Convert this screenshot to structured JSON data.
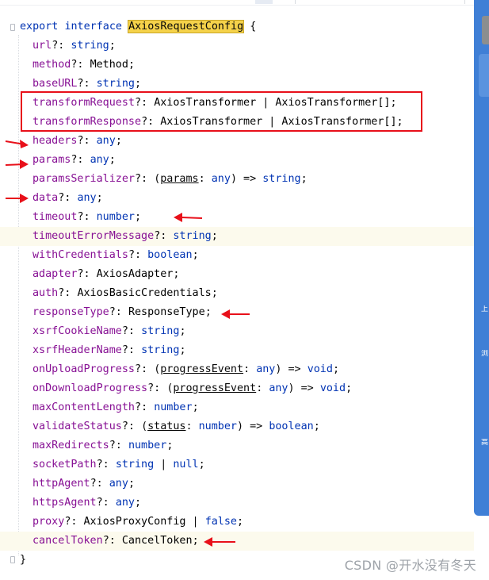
{
  "code": {
    "open": {
      "kw1": "export",
      "kw2": "interface",
      "name": "AxiosRequestConfig",
      "brace": "{"
    },
    "close": "}",
    "lines": [
      {
        "name": "url",
        "opt": "?: ",
        "type": "string",
        "suffix": ";"
      },
      {
        "name": "method",
        "opt": "?: ",
        "type": "Method",
        "suffix": ";"
      },
      {
        "name": "baseURL",
        "opt": "?: ",
        "type": "string",
        "suffix": ";"
      },
      {
        "name": "transformRequest",
        "opt": "?: ",
        "type": "AxiosTransformer | AxiosTransformer[]",
        "suffix": ";"
      },
      {
        "name": "transformResponse",
        "opt": "?: ",
        "type": "AxiosTransformer | AxiosTransformer[]",
        "suffix": ";"
      },
      {
        "name": "headers",
        "opt": "?: ",
        "type": "any",
        "suffix": ";"
      },
      {
        "name": "params",
        "opt": "?: ",
        "type": "any",
        "suffix": ";"
      },
      {
        "name": "paramsSerializer",
        "opt": "?: ",
        "fn_open": "(",
        "param": "params",
        "colon": ": ",
        "ptype": "any",
        "fn_close": ") => ",
        "type": "string",
        "suffix": ";"
      },
      {
        "name": "data",
        "opt": "?: ",
        "type": "any",
        "suffix": ";"
      },
      {
        "name": "timeout",
        "opt": "?: ",
        "type": "number",
        "suffix": ";"
      },
      {
        "name": "timeoutErrorMessage",
        "opt": "?: ",
        "type": "string",
        "suffix": ";"
      },
      {
        "name": "withCredentials",
        "opt": "?: ",
        "type": "boolean",
        "suffix": ";"
      },
      {
        "name": "adapter",
        "opt": "?: ",
        "type": "AxiosAdapter",
        "suffix": ";"
      },
      {
        "name": "auth",
        "opt": "?: ",
        "type": "AxiosBasicCredentials",
        "suffix": ";"
      },
      {
        "name": "responseType",
        "opt": "?: ",
        "type": "ResponseType",
        "suffix": ";"
      },
      {
        "name": "xsrfCookieName",
        "opt": "?: ",
        "type": "string",
        "suffix": ";"
      },
      {
        "name": "xsrfHeaderName",
        "opt": "?: ",
        "type": "string",
        "suffix": ";"
      },
      {
        "name": "onUploadProgress",
        "opt": "?: ",
        "fn_open": "(",
        "param": "progressEvent",
        "colon": ": ",
        "ptype": "any",
        "fn_close": ") => ",
        "type": "void",
        "suffix": ";"
      },
      {
        "name": "onDownloadProgress",
        "opt": "?: ",
        "fn_open": "(",
        "param": "progressEvent",
        "colon": ": ",
        "ptype": "any",
        "fn_close": ") => ",
        "type": "void",
        "suffix": ";"
      },
      {
        "name": "maxContentLength",
        "opt": "?: ",
        "type": "number",
        "suffix": ";"
      },
      {
        "name": "validateStatus",
        "opt": "?: ",
        "fn_open": "(",
        "param": "status",
        "colon": ": ",
        "ptype": "number",
        "fn_close": ") => ",
        "type": "boolean",
        "suffix": ";"
      },
      {
        "name": "maxRedirects",
        "opt": "?: ",
        "type": "number",
        "suffix": ";"
      },
      {
        "name": "socketPath",
        "opt": "?: ",
        "type": "string",
        "sep": " | ",
        "type2": "null",
        "suffix": ";"
      },
      {
        "name": "httpAgent",
        "opt": "?: ",
        "type": "any",
        "suffix": ";"
      },
      {
        "name": "httpsAgent",
        "opt": "?: ",
        "type": "any",
        "suffix": ";"
      },
      {
        "name": "proxy",
        "opt": "?: ",
        "type": "AxiosProxyConfig",
        "sep": " | ",
        "type2": "false",
        "suffix": ";"
      },
      {
        "name": "cancelToken",
        "opt": "?: ",
        "type": "CancelToken",
        "suffix": ";"
      }
    ]
  },
  "sidebar": {
    "glyphs": [
      "上",
      "浏",
      "高"
    ]
  },
  "watermark": "CSDN @开水没有冬天",
  "colors": {
    "keyword": "#0033b3",
    "property": "#871094",
    "highlight_box": "#e8101a",
    "arrow": "#e8101a",
    "interface_highlight": "#f5d24a"
  }
}
